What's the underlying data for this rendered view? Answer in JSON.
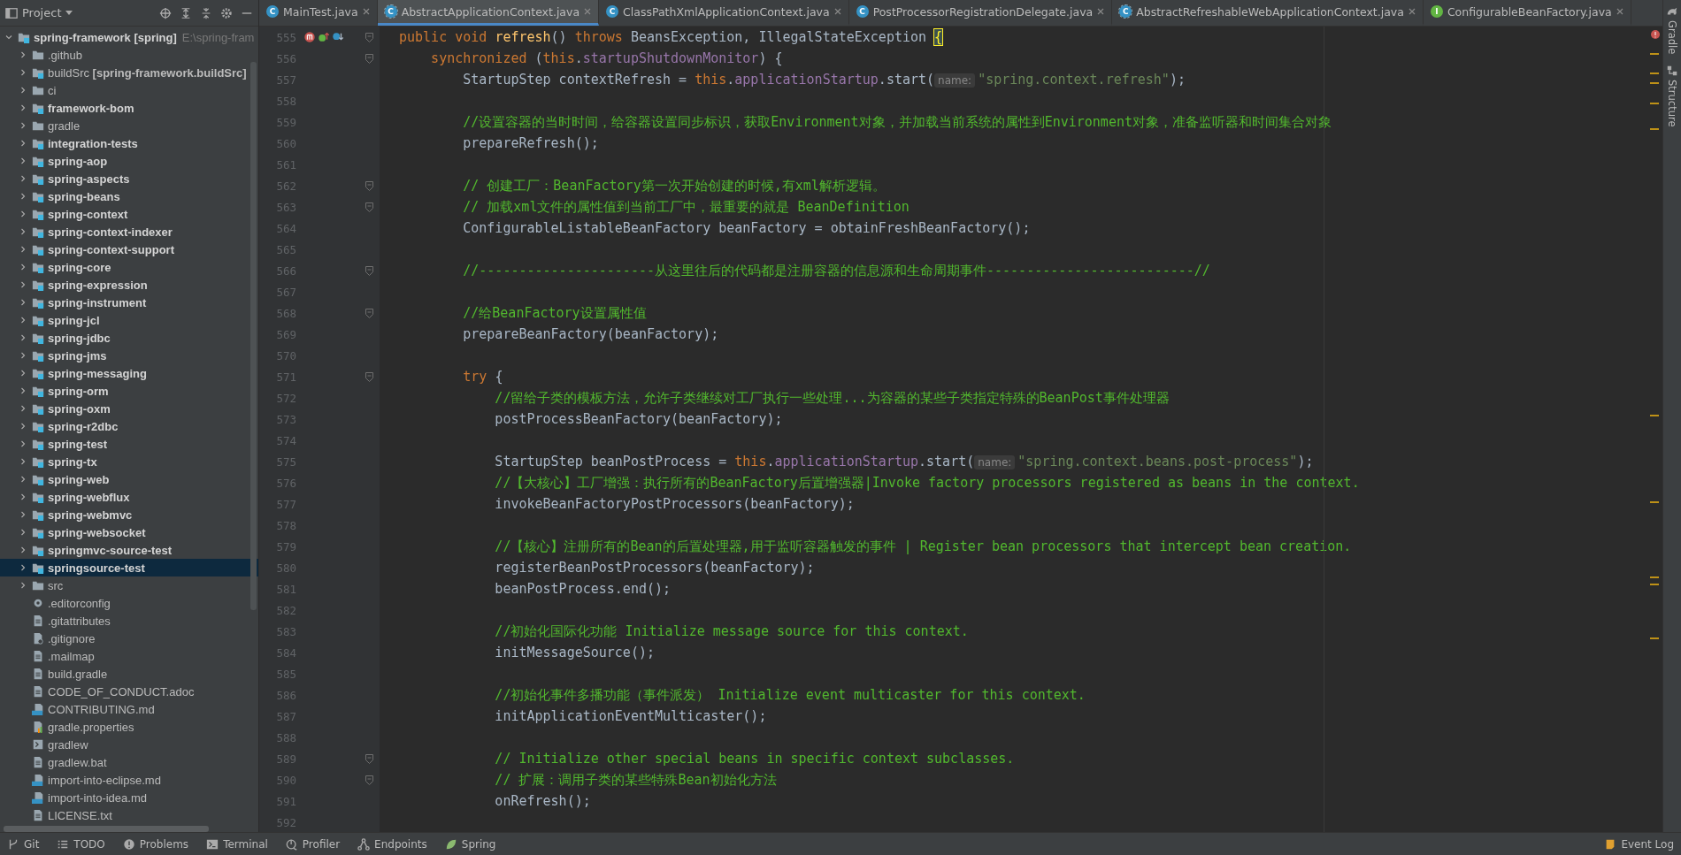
{
  "project_panel": {
    "title": "Project",
    "tree": [
      {
        "label": "spring-framework **[spring]**",
        "path": "E:\\spring-fram",
        "kind": "module",
        "expanded": true,
        "selected": false,
        "children": [
          {
            "label": ".github",
            "kind": "folder",
            "expanded": false,
            "selected": false
          },
          {
            "label": "buildSrc **[spring-framework.buildSrc]**",
            "kind": "module-plain",
            "expanded": false,
            "selected": false
          },
          {
            "label": "ci",
            "kind": "folder",
            "expanded": false,
            "selected": false
          },
          {
            "label": "framework-bom",
            "kind": "module",
            "expanded": false,
            "selected": false
          },
          {
            "label": "gradle",
            "kind": "folder",
            "expanded": false,
            "selected": false
          },
          {
            "label": "integration-tests",
            "kind": "module",
            "expanded": false,
            "selected": false
          },
          {
            "label": "spring-aop",
            "kind": "module",
            "expanded": false,
            "selected": false
          },
          {
            "label": "spring-aspects",
            "kind": "module",
            "expanded": false,
            "selected": false
          },
          {
            "label": "spring-beans",
            "kind": "module",
            "expanded": false,
            "selected": false
          },
          {
            "label": "spring-context",
            "kind": "module",
            "expanded": false,
            "selected": false
          },
          {
            "label": "spring-context-indexer",
            "kind": "module",
            "expanded": false,
            "selected": false
          },
          {
            "label": "spring-context-support",
            "kind": "module",
            "expanded": false,
            "selected": false
          },
          {
            "label": "spring-core",
            "kind": "module",
            "expanded": false,
            "selected": false
          },
          {
            "label": "spring-expression",
            "kind": "module",
            "expanded": false,
            "selected": false
          },
          {
            "label": "spring-instrument",
            "kind": "module",
            "expanded": false,
            "selected": false
          },
          {
            "label": "spring-jcl",
            "kind": "module",
            "expanded": false,
            "selected": false
          },
          {
            "label": "spring-jdbc",
            "kind": "module",
            "expanded": false,
            "selected": false
          },
          {
            "label": "spring-jms",
            "kind": "module",
            "expanded": false,
            "selected": false
          },
          {
            "label": "spring-messaging",
            "kind": "module",
            "expanded": false,
            "selected": false
          },
          {
            "label": "spring-orm",
            "kind": "module",
            "expanded": false,
            "selected": false
          },
          {
            "label": "spring-oxm",
            "kind": "module",
            "expanded": false,
            "selected": false
          },
          {
            "label": "spring-r2dbc",
            "kind": "module",
            "expanded": false,
            "selected": false
          },
          {
            "label": "spring-test",
            "kind": "module",
            "expanded": false,
            "selected": false
          },
          {
            "label": "spring-tx",
            "kind": "module",
            "expanded": false,
            "selected": false
          },
          {
            "label": "spring-web",
            "kind": "module",
            "expanded": false,
            "selected": false
          },
          {
            "label": "spring-webflux",
            "kind": "module",
            "expanded": false,
            "selected": false
          },
          {
            "label": "spring-webmvc",
            "kind": "module",
            "expanded": false,
            "selected": false
          },
          {
            "label": "spring-websocket",
            "kind": "module",
            "expanded": false,
            "selected": false
          },
          {
            "label": "springmvc-source-test",
            "kind": "module",
            "expanded": false,
            "selected": false
          },
          {
            "label": "springsource-test",
            "kind": "module",
            "expanded": false,
            "selected": true
          },
          {
            "label": "src",
            "kind": "folder",
            "expanded": false,
            "selected": false
          },
          {
            "label": ".editorconfig",
            "kind": "config",
            "selected": false
          },
          {
            "label": ".gitattributes",
            "kind": "text",
            "selected": false
          },
          {
            "label": ".gitignore",
            "kind": "ignore",
            "selected": false
          },
          {
            "label": ".mailmap",
            "kind": "text",
            "selected": false
          },
          {
            "label": "build.gradle",
            "kind": "text",
            "selected": false
          },
          {
            "label": "CODE_OF_CONDUCT.adoc",
            "kind": "text",
            "selected": false
          },
          {
            "label": "CONTRIBUTING.md",
            "kind": "markdown",
            "selected": false
          },
          {
            "label": "gradle.properties",
            "kind": "properties",
            "selected": false
          },
          {
            "label": "gradlew",
            "kind": "script",
            "selected": false
          },
          {
            "label": "gradlew.bat",
            "kind": "text",
            "selected": false
          },
          {
            "label": "import-into-eclipse.md",
            "kind": "markdown",
            "selected": false
          },
          {
            "label": "import-into-idea.md",
            "kind": "markdown",
            "selected": false
          },
          {
            "label": "LICENSE.txt",
            "kind": "text",
            "selected": false
          }
        ]
      }
    ]
  },
  "editor_tabs": [
    {
      "label": "MainTest.java",
      "kind": "class",
      "letter": "C",
      "selected": false
    },
    {
      "label": "AbstractApplicationContext.java",
      "kind": "abstract",
      "letter": "C",
      "selected": true
    },
    {
      "label": "ClassPathXmlApplicationContext.java",
      "kind": "class",
      "letter": "C",
      "selected": false
    },
    {
      "label": "PostProcessorRegistrationDelegate.java",
      "kind": "class",
      "letter": "C",
      "selected": false
    },
    {
      "label": "AbstractRefreshableWebApplicationContext.java",
      "kind": "abstract",
      "letter": "C",
      "selected": false
    },
    {
      "label": "ConfigurableBeanFactory.java",
      "kind": "interface",
      "letter": "I",
      "selected": false
    }
  ],
  "code": [
    {
      "number": "555",
      "fold": true,
      "gutter_icons": [
        {
          "kind": "recursion"
        },
        {
          "kind": "overrides"
        },
        {
          "kind": "overridden"
        }
      ],
      "tokens": [
        {
          "text": "public void ",
          "kind": "kw"
        },
        {
          "text": "refresh",
          "kind": "decl"
        },
        {
          "text": "() ",
          "kind": "plain"
        },
        {
          "text": "throws ",
          "kind": "kw"
        },
        {
          "text": "BeansException, IllegalStateException ",
          "kind": "plain"
        },
        {
          "text": "{",
          "kind": "brace"
        }
      ]
    },
    {
      "number": "556",
      "fold": true,
      "tokens": [
        {
          "text": "    synchronized ",
          "kind": "kw"
        },
        {
          "text": "(",
          "kind": "plain"
        },
        {
          "text": "this",
          "kind": "kw"
        },
        {
          "text": ".",
          "kind": "plain"
        },
        {
          "text": "startupShutdownMonitor",
          "kind": "field"
        },
        {
          "text": ") {",
          "kind": "plain"
        }
      ]
    },
    {
      "number": "557",
      "fold": false,
      "tokens": [
        {
          "text": "        StartupStep contextRefresh = ",
          "kind": "plain"
        },
        {
          "text": "this",
          "kind": "kw"
        },
        {
          "text": ".",
          "kind": "plain"
        },
        {
          "text": "applicationStartup",
          "kind": "field"
        },
        {
          "text": ".start(",
          "kind": "plain"
        },
        {
          "text": "name:",
          "kind": "hint"
        },
        {
          "text": "\"spring.context.refresh\"",
          "kind": "string"
        },
        {
          "text": ");",
          "kind": "plain"
        }
      ]
    },
    {
      "number": "558",
      "fold": false
    },
    {
      "number": "559",
      "fold": false,
      "tokens": [
        {
          "text": "        //设置容器的当时时间，给容器设置同步标识，获取Environment对象，并加载当前系统的属性到Environment对象，准备监听器和时间集合对象",
          "kind": "comment"
        }
      ]
    },
    {
      "number": "560",
      "fold": false,
      "tokens": [
        {
          "text": "        prepareRefresh();",
          "kind": "plain"
        }
      ]
    },
    {
      "number": "561",
      "fold": false
    },
    {
      "number": "562",
      "fold": true,
      "tokens": [
        {
          "text": "        // 创建工厂：BeanFactory第一次开始创建的时候,有xml解析逻辑。",
          "kind": "comment"
        }
      ]
    },
    {
      "number": "563",
      "fold": true,
      "tokens": [
        {
          "text": "        // 加载xml文件的属性值到当前工厂中，最重要的就是 BeanDefinition",
          "kind": "comment"
        }
      ]
    },
    {
      "number": "564",
      "fold": false,
      "tokens": [
        {
          "text": "        ConfigurableListableBeanFactory beanFactory = obtainFreshBeanFactory();",
          "kind": "plain"
        }
      ]
    },
    {
      "number": "565",
      "fold": false
    },
    {
      "number": "566",
      "fold": true,
      "tokens": [
        {
          "text": "        //----------------------从这里往后的代码都是注册容器的信息源和生命周期事件--------------------------//",
          "kind": "comment"
        }
      ]
    },
    {
      "number": "567",
      "fold": false
    },
    {
      "number": "568",
      "fold": true,
      "tokens": [
        {
          "text": "        //给BeanFactory设置属性值",
          "kind": "comment"
        }
      ]
    },
    {
      "number": "569",
      "fold": false,
      "tokens": [
        {
          "text": "        prepareBeanFactory(beanFactory);",
          "kind": "plain"
        }
      ]
    },
    {
      "number": "570",
      "fold": false
    },
    {
      "number": "571",
      "fold": true,
      "tokens": [
        {
          "text": "        try ",
          "kind": "kw"
        },
        {
          "text": "{",
          "kind": "plain"
        }
      ]
    },
    {
      "number": "572",
      "fold": false,
      "tokens": [
        {
          "text": "            //留给子类的模板方法，允许子类继续对工厂执行一些处理...为容器的某些子类指定特殊的BeanPost事件处理器",
          "kind": "comment"
        }
      ]
    },
    {
      "number": "573",
      "fold": false,
      "tokens": [
        {
          "text": "            postProcessBeanFactory(beanFactory);",
          "kind": "plain"
        }
      ]
    },
    {
      "number": "574",
      "fold": false
    },
    {
      "number": "575",
      "fold": false,
      "tokens": [
        {
          "text": "            StartupStep beanPostProcess = ",
          "kind": "plain"
        },
        {
          "text": "this",
          "kind": "kw"
        },
        {
          "text": ".",
          "kind": "plain"
        },
        {
          "text": "applicationStartup",
          "kind": "field"
        },
        {
          "text": ".start(",
          "kind": "plain"
        },
        {
          "text": "name:",
          "kind": "hint"
        },
        {
          "text": "\"spring.context.beans.post-process\"",
          "kind": "string"
        },
        {
          "text": ");",
          "kind": "plain"
        }
      ]
    },
    {
      "number": "576",
      "fold": false,
      "tokens": [
        {
          "text": "            //【大核心】工厂增强：执行所有的BeanFactory后置增强器|Invoke factory processors registered as beans in the context.",
          "kind": "comment"
        }
      ]
    },
    {
      "number": "577",
      "fold": false,
      "tokens": [
        {
          "text": "            invokeBeanFactoryPostProcessors(beanFactory);",
          "kind": "plain"
        }
      ]
    },
    {
      "number": "578",
      "fold": false
    },
    {
      "number": "579",
      "fold": false,
      "tokens": [
        {
          "text": "            //【核心】注册所有的Bean的后置处理器,用于监听容器触发的事件 | Register bean processors that intercept bean creation.",
          "kind": "comment"
        }
      ]
    },
    {
      "number": "580",
      "fold": false,
      "tokens": [
        {
          "text": "            registerBeanPostProcessors(beanFactory);",
          "kind": "plain"
        }
      ]
    },
    {
      "number": "581",
      "fold": false,
      "tokens": [
        {
          "text": "            beanPostProcess.end();",
          "kind": "plain"
        }
      ]
    },
    {
      "number": "582",
      "fold": false
    },
    {
      "number": "583",
      "fold": false,
      "tokens": [
        {
          "text": "            //初始化国际化功能 Initialize message source for this context.",
          "kind": "comment"
        }
      ]
    },
    {
      "number": "584",
      "fold": false,
      "tokens": [
        {
          "text": "            initMessageSource();",
          "kind": "plain"
        }
      ]
    },
    {
      "number": "585",
      "fold": false
    },
    {
      "number": "586",
      "fold": false,
      "tokens": [
        {
          "text": "            //初始化事件多播功能（事件派发） Initialize event multicaster for this context.",
          "kind": "comment"
        }
      ]
    },
    {
      "number": "587",
      "fold": false,
      "tokens": [
        {
          "text": "            initApplicationEventMulticaster();",
          "kind": "plain"
        }
      ]
    },
    {
      "number": "588",
      "fold": false
    },
    {
      "number": "589",
      "fold": true,
      "tokens": [
        {
          "text": "            // Initialize other special beans in specific context subclasses.",
          "kind": "comment"
        }
      ]
    },
    {
      "number": "590",
      "fold": true,
      "tokens": [
        {
          "text": "            // 扩展：调用子类的某些特殊Bean初始化方法",
          "kind": "comment"
        }
      ]
    },
    {
      "number": "591",
      "fold": false,
      "tokens": [
        {
          "text": "            onRefresh();",
          "kind": "plain"
        }
      ]
    },
    {
      "number": "592",
      "fold": false
    }
  ],
  "right_tool_tabs": [
    {
      "label": "Gradle",
      "kind": "gradle"
    },
    {
      "label": "Structure",
      "kind": "structure"
    }
  ],
  "status_bar": {
    "tools": [
      {
        "label": "Git",
        "kind": "git"
      },
      {
        "label": "TODO",
        "kind": "todo"
      },
      {
        "label": "Problems",
        "kind": "problems"
      },
      {
        "label": "Terminal",
        "kind": "terminal"
      },
      {
        "label": "Profiler",
        "kind": "profiler"
      },
      {
        "label": "Endpoints",
        "kind": "endpoints"
      },
      {
        "label": "Spring",
        "kind": "spring"
      }
    ],
    "right": {
      "label": "Event Log",
      "kind": "eventlog"
    }
  }
}
